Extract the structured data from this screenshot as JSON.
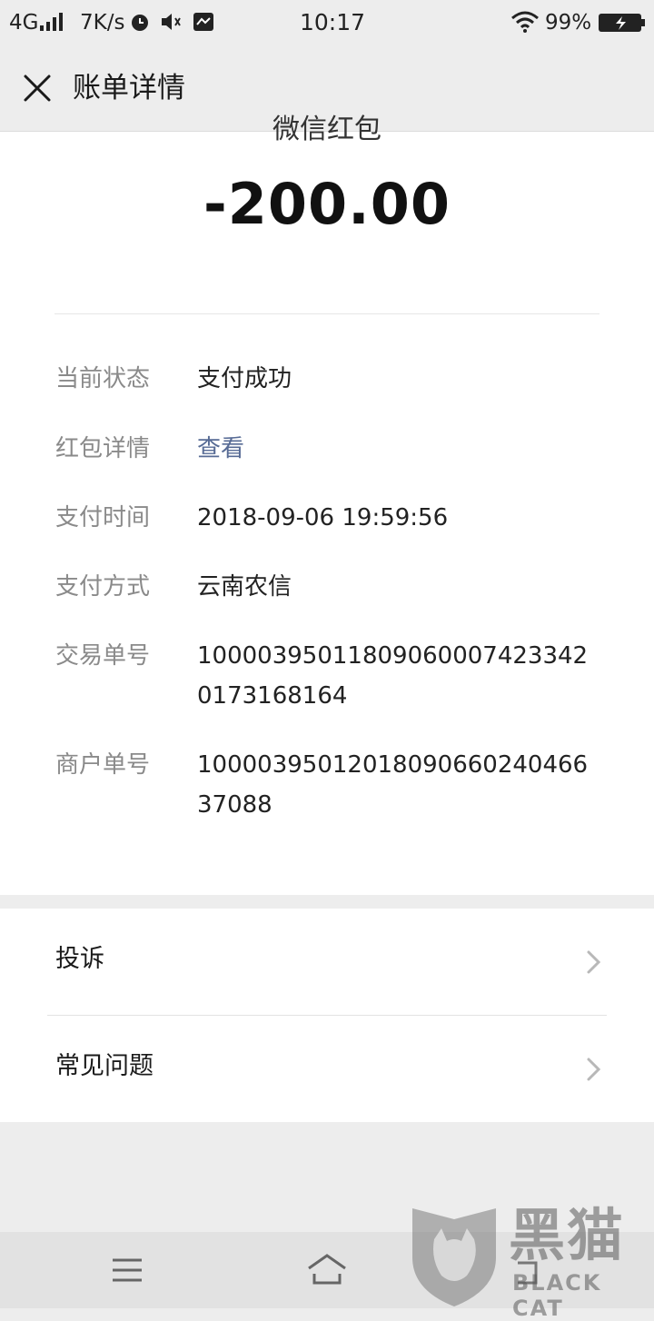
{
  "status_bar": {
    "network": "4G",
    "speed": "7K/s",
    "time": "10:17",
    "battery": "99%"
  },
  "header": {
    "title": "账单详情",
    "close_icon": "close-icon"
  },
  "bill": {
    "cut_title": "微信红包",
    "amount": "-200.00",
    "rows": [
      {
        "label": "当前状态",
        "value": "支付成功"
      },
      {
        "label": "红包详情",
        "value": "查看"
      },
      {
        "label": "支付时间",
        "value": "2018-09-06 19:59:56"
      },
      {
        "label": "支付方式",
        "value": "云南农信"
      },
      {
        "label": "交易单号",
        "value": "10000395011809060007423342 0173168164"
      },
      {
        "label": "商户单号",
        "value": "10000395012018090660240466 37088"
      }
    ],
    "link_color": "#576b95"
  },
  "list": {
    "items": [
      {
        "label": "投诉",
        "icon": "chevron-right-icon"
      },
      {
        "label": "常见问题",
        "icon": "chevron-right-icon"
      }
    ]
  },
  "nav": {
    "icons": [
      "menu-icon",
      "home-icon",
      "back-icon"
    ]
  },
  "watermark": {
    "cn": "黑猫",
    "en": "BLACK CAT",
    "icon": "cat-shield-icon"
  }
}
